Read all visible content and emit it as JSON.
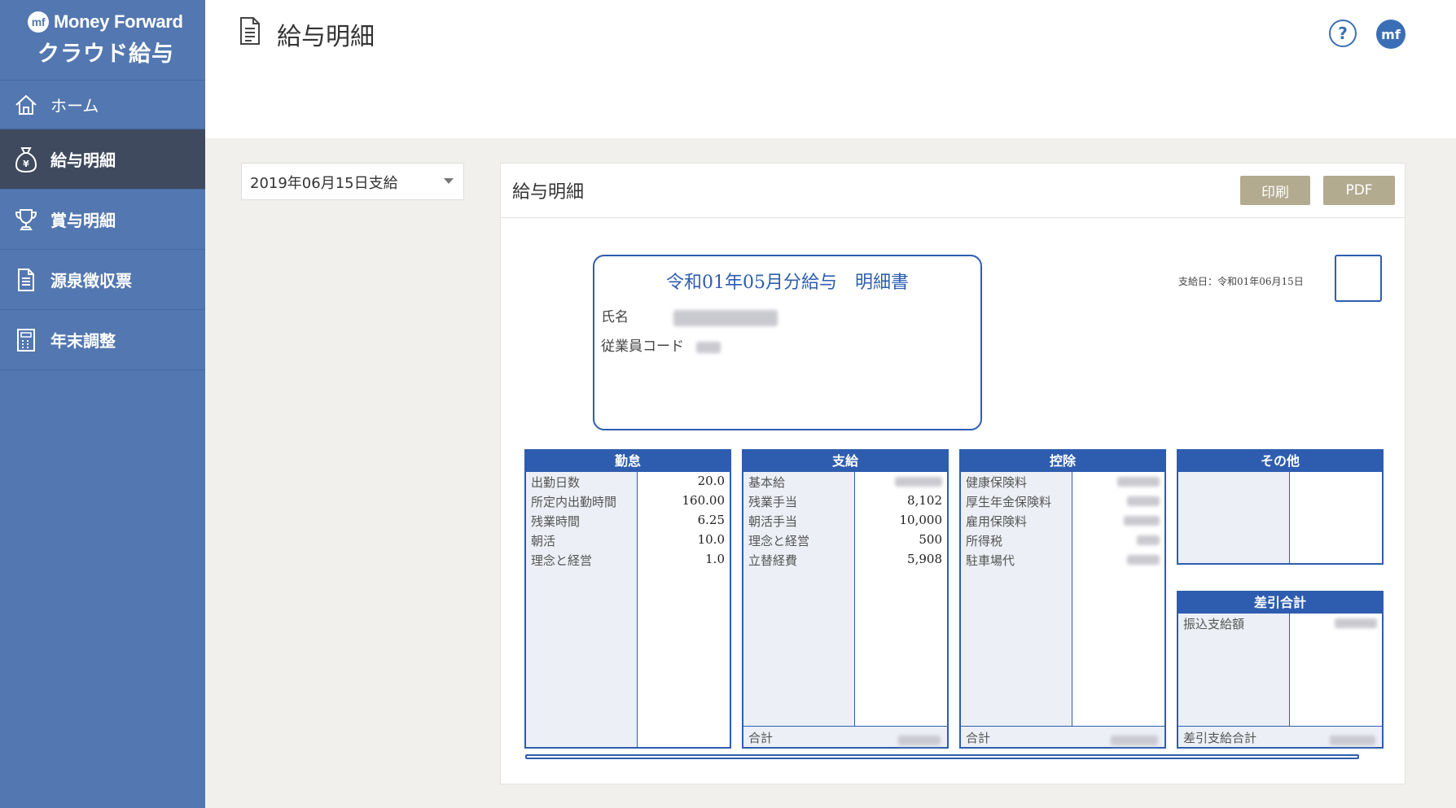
{
  "sidebar": {
    "brand_top": "Money Forward",
    "brand_bottom": "クラウド給与",
    "items": [
      {
        "label": "ホーム"
      },
      {
        "label": "給与明細"
      },
      {
        "label": "賞与明細"
      },
      {
        "label": "源泉徴収票"
      },
      {
        "label": "年末調整"
      }
    ]
  },
  "header": {
    "title": "給与明細",
    "help": "?"
  },
  "date_select": {
    "value": "2019年06月15日支給"
  },
  "panel": {
    "title": "給与明細",
    "print_label": "印刷",
    "pdf_label": "PDF"
  },
  "slip": {
    "title": "令和01年05月分給与　明細書",
    "name_label": "氏名",
    "code_label": "従業員コード",
    "payday": "支給日：令和01年06月15日"
  },
  "attendance": {
    "title": "勤怠",
    "rows": [
      {
        "label": "出勤日数",
        "value": "20.0"
      },
      {
        "label": "所定内出勤時間",
        "value": "160.00"
      },
      {
        "label": "残業時間",
        "value": "6.25"
      },
      {
        "label": "朝活",
        "value": "10.0"
      },
      {
        "label": "理念と経営",
        "value": "1.0"
      }
    ]
  },
  "payment": {
    "title": "支給",
    "rows": [
      {
        "label": "基本給",
        "value": ""
      },
      {
        "label": "残業手当",
        "value": "8,102"
      },
      {
        "label": "朝活手当",
        "value": "10,000"
      },
      {
        "label": "理念と経営",
        "value": "500"
      },
      {
        "label": "立替経費",
        "value": "5,908"
      }
    ],
    "total_label": "合計"
  },
  "deduction": {
    "title": "控除",
    "rows": [
      {
        "label": "健康保険料",
        "value": ""
      },
      {
        "label": "厚生年金保険料",
        "value": ""
      },
      {
        "label": "雇用保険料",
        "value": ""
      },
      {
        "label": "所得税",
        "value": ""
      },
      {
        "label": "駐車場代",
        "value": ""
      }
    ],
    "total_label": "合計"
  },
  "other": {
    "title": "その他"
  },
  "net": {
    "title": "差引合計",
    "rows": [
      {
        "label": "振込支給額",
        "value": ""
      }
    ],
    "total_label": "差引支給合計"
  },
  "colors": {
    "sidebar": "#5377b0",
    "sidebar_active": "#3f4a5e",
    "slip_blue": "#2e5db0",
    "button": "#b2ab90"
  }
}
